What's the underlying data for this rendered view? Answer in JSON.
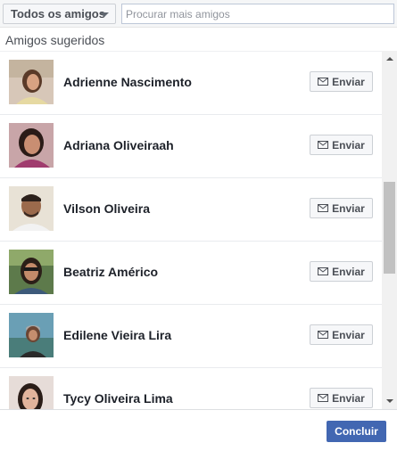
{
  "header": {
    "filter_label": "Todos os amigos",
    "search_placeholder": "Procurar mais amigos",
    "search_value": ""
  },
  "section_title": "Amigos sugeridos",
  "friends": [
    {
      "name": "Adrienne Nascimento",
      "send_label": "Enviar"
    },
    {
      "name": "Adriana Oliveiraah",
      "send_label": "Enviar"
    },
    {
      "name": "Vilson Oliveira",
      "send_label": "Enviar"
    },
    {
      "name": "Beatriz Américo",
      "send_label": "Enviar"
    },
    {
      "name": "Edilene Vieira Lira",
      "send_label": "Enviar"
    },
    {
      "name": "Tycy Oliveira Lima",
      "send_label": "Enviar"
    }
  ],
  "footer": {
    "done_label": "Concluir"
  },
  "colors": {
    "accent": "#4267b2",
    "text": "#1d2129",
    "muted": "#4b4f56"
  },
  "icons": {
    "filter": "chevron-down-icon",
    "send": "envelope-icon"
  }
}
